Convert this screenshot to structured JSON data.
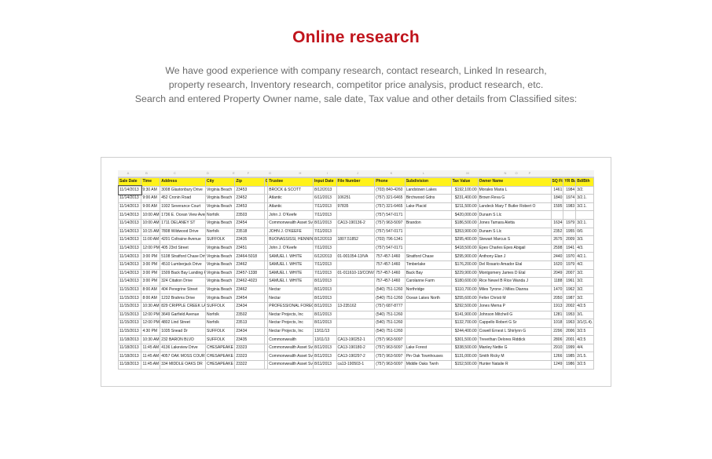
{
  "title": "Online research",
  "intro": [
    "We have good experience with company research, contact research, Linked In research,",
    "property research,  Inventory research, competitor price analysis, product research, etc.",
    "Search and entered Property Owner name, sale date, Tax value and other details from Classified sites:"
  ],
  "spreadsheet": {
    "column_letters": [
      "A",
      "B",
      "C",
      "D",
      "E",
      "F",
      "G",
      "H",
      "I",
      "J",
      "K",
      "L",
      "M",
      "N",
      "O",
      "P"
    ],
    "headers": [
      "Sale Date",
      "Time",
      "Address",
      "City",
      "Zip",
      "C",
      "Trustee",
      "Input Date",
      "File Number",
      "Phone",
      "Subdivision",
      "Tax Value",
      "Owner Name",
      "SQ Ft",
      "YR Built",
      "Bd/Bth"
    ],
    "rows": [
      [
        "11/14/2013",
        "9:30 AM",
        "3008 Glastonbury Drive",
        "Virginia Beach",
        "23453",
        "",
        "BROCK & SCOTT",
        "8/12/2013",
        "",
        "(703) 840-4260",
        "Landstown Lakes",
        "$192,100.00",
        "Morales Maria L",
        "1461",
        "1984",
        "3/2."
      ],
      [
        "11/14/2013",
        "9:00 AM",
        "452 Cronin Road",
        "Virginia Beach",
        "23452",
        "",
        "Atlantic",
        "6/11/2013",
        "106251",
        "(757) 321-6465",
        "Birchwood Gdns",
        "$231,400.00",
        "Brown Reva G",
        "1840",
        "1974",
        "3/2.1."
      ],
      [
        "11/14/2013",
        "9:00 AM",
        "1932 Severance Court",
        "Virginia Beach",
        "23453",
        "",
        "Atlantic",
        "7/11/2013",
        "97835",
        "(757) 321-6465",
        "Lake Placid",
        "$211,500.00",
        "Landeck Mary T Butler Robert O",
        "1595",
        "1983",
        "3/2.1."
      ],
      [
        "11/14/2013",
        "10:00 AM",
        "1736 E. Ocean View Avenue",
        "Norfolk",
        "23503",
        "",
        "John J. O'Keefe",
        "7/11/2013",
        "",
        "(757) 547-0171",
        "",
        "$420,000.00",
        "Dunam S Llc",
        "",
        "",
        ""
      ],
      [
        "11/14/2013",
        "10:00 AM",
        "1711 DELANEY ST",
        "Virginia Beach",
        "23454",
        "",
        "Commonwealth Asset Svcs",
        "8/11/2013",
        "CA13-190136-2",
        "(757) 963-5097",
        "Brandon",
        "$186,500.00",
        "Jones Tamara Aletta",
        "1634",
        "1979",
        "3/2.1."
      ],
      [
        "11/14/2013",
        "10:15 AM",
        "7808 Wildwood Drive",
        "Norfolk",
        "23518",
        "",
        "JOHN J. O'KEEFE",
        "7/11/2013",
        "",
        "(757) 547-0171",
        "",
        "$353,900.00",
        "Dunam S Llc",
        "2352",
        "1955",
        "0/0."
      ],
      [
        "11/14/2013",
        "11:00 AM",
        "4201 Coltraine Avenue",
        "SUFFOLK",
        "23435",
        "",
        "BUONASSISSI, HENNING",
        "8/12/2013",
        "1807.51852",
        "(703) 796-1341",
        "",
        "$295,400.00",
        "Stewart Marcus S",
        "2675",
        "2009",
        "3/3."
      ],
      [
        "11/14/2013",
        "12:00 PM",
        "405 23rd Street",
        "Virginia Beach",
        "23451",
        "",
        "John J. O'Keefe",
        "7/11/2013",
        "",
        "(757) 547-0171",
        "",
        "$418,500.00",
        "Epes Charles Epes Abigail",
        "2598",
        "1941",
        "4/3."
      ],
      [
        "11/14/2013",
        "3:00 PM",
        "5108 Stratford Chase Drive",
        "Virginia Beach",
        "23464-5018",
        "",
        "SAMUEL I. WHITE",
        "6/12/2013",
        "01-001054-13/VA",
        "757-457-1460",
        "Stratford Chase",
        "$295,900.00",
        "Anthony Elan J",
        "2440",
        "1970",
        "4/2.1."
      ],
      [
        "11/14/2013",
        "3:00 PM",
        "4510 Lumberjack Drive",
        "Virginia Beach",
        "23462",
        "",
        "SAMUEL I. WHITE",
        "7/11/2013",
        "",
        "757-457-1460",
        "Timberlake",
        "$176,200.00",
        "Del Rosario Amador Etal",
        "1620",
        "1979",
        "4/2."
      ],
      [
        "11/14/2013",
        "3:00 PM",
        "1509 Back Bay Landing Rd",
        "Virginia Beach",
        "23457-1338",
        "",
        "SAMUEL I. WHITE",
        "7/11/2013",
        "01-011610-13/CONV",
        "757-457-1460",
        "Back Bay",
        "$229,900.00",
        "Montgomery James D Etal",
        "2049",
        "2007",
        "3/2."
      ],
      [
        "11/14/2013",
        "3:00 PM",
        "324 Citation Drive",
        "Virginia Beach",
        "23462-4023",
        "",
        "SAMUEL I. WHITE",
        "8/11/2013",
        "",
        "757-457-1460",
        "Carolanne Farm",
        "$180,600.00",
        "Rice Newel B Rice Wanda J",
        "1188",
        "1961",
        "3/2."
      ],
      [
        "11/15/2013",
        "8:00 AM",
        "404 Peregrine Street",
        "Virginia Beach",
        "23462",
        "",
        "Nectar",
        "8/11/2013",
        "",
        "(540) 751-1260",
        "Northridge",
        "$110,700.00",
        "Miles Tyrone J Miles Dianna",
        "1470",
        "1962",
        "3/2."
      ],
      [
        "11/15/2013",
        "8:00 AM",
        "1232 Brahms Drive",
        "Virginia Beach",
        "23454",
        "",
        "Nectar",
        "8/11/2013",
        "",
        "(540) 751-1260",
        "Ocean Lakes North",
        "$255,600.00",
        "Felter Christi M",
        "2050",
        "1987",
        "3/2."
      ],
      [
        "11/15/2013",
        "10:30 AM",
        "829 CRIPPLE CREEK LANE",
        "SUFFOLK",
        "23434",
        "",
        "PROFESSIONAL FORECLOSURE",
        "8/11/2013",
        "13-235162",
        "(757) 687-8777",
        "",
        "$292,500.00",
        "Jones Mema P",
        "1913",
        "2002",
        "4/2.5"
      ],
      [
        "11/15/2013",
        "12:00 PM",
        "3649 Garfield Avenue",
        "Norfolk",
        "23502",
        "",
        "Nectar Projects, Inc",
        "8/11/2013",
        "",
        "(540) 751-1260",
        "",
        "$141,900.00",
        "Johnson Mitchell G",
        "1281",
        "1953",
        "3/1."
      ],
      [
        "11/15/2013",
        "12:00 PM",
        "4802 Lind Street",
        "Norfolk",
        "23513",
        "",
        "Nectar Projects, Inc",
        "8/11/2013",
        "",
        "(540) 751-1260",
        "",
        "$132,700.00",
        "Cappello Robert G Sr",
        "1018",
        "1963",
        "3/1/(1.4)."
      ],
      [
        "11/15/2013",
        "4:30 PM",
        "1035 Snead Dr",
        "SUFFOLK",
        "23434",
        "",
        "Nectar Projects, Inc",
        "13/11/13",
        "",
        "(540) 751-1260",
        "",
        "$244,400.00",
        "Cowell Ernest L Shirlynn G",
        "2296",
        "2006",
        "3/2.5"
      ],
      [
        "11/18/2013",
        "10:30 AM",
        "232 BARON BLVD",
        "SUFFOLK",
        "23435",
        "",
        "Commonwealth",
        "13/11/13",
        "CA13-190252-1",
        "(757) 963-5097",
        "",
        "$301,500.00",
        "Trevethan Delores Riddick",
        "2806",
        "2001",
        "4/2.5"
      ],
      [
        "11/18/2013",
        "11:45 AM",
        "4136 Lakeview Drive",
        "CHESAPEAKE",
        "23323",
        "",
        "Commonwealth Asset Svcs",
        "8/11/2013",
        "CA13-190180-2",
        "(757) 963-5097",
        "Lake Forest",
        "$338,500.00",
        "Manley Nettie G",
        "2910",
        "1999",
        "4/4."
      ],
      [
        "11/18/2013",
        "11:45 AM",
        "4057 OAK MOSS COURT",
        "CHESAPEAKE",
        "23323",
        "",
        "Commonwealth Asset Svcs",
        "8/11/2013",
        "CA13-190297-2",
        "(757) 963-5097",
        "Pin Oak Townhouses",
        "$131,000.00",
        "Smith Ricky M",
        "1266",
        "1985",
        "2/1.5."
      ],
      [
        "11/18/2013",
        "11:45 AM",
        "334 MIDDLE OAKS DR",
        "CHESAPEAKE",
        "23322",
        "",
        "Commonwealth Asset Svcs",
        "8/11/2013",
        "ca13-190503-1",
        "(757) 963-5097",
        "Middle Oaks Twnh",
        "$152,500.00",
        "Hunter Natalie R",
        "1249",
        "1986",
        "3/2.5"
      ]
    ]
  },
  "colors": {
    "title": "#c0141c",
    "body_text": "#6b6b6b",
    "header_fill": "#fff21a",
    "grid_line": "#c9c9c9"
  }
}
